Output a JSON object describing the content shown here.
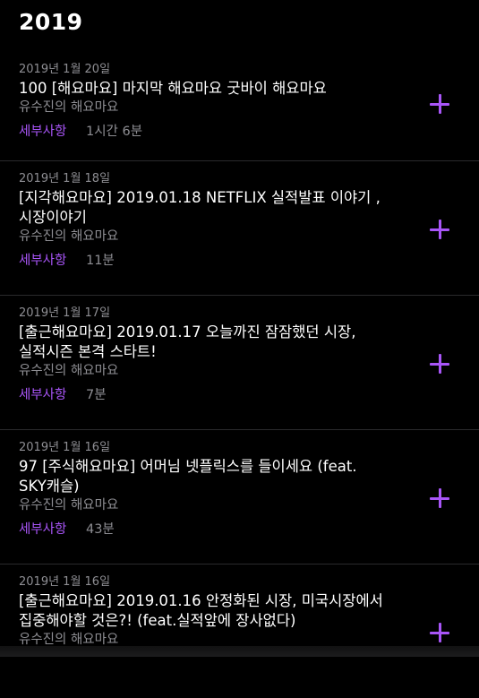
{
  "year": "2019",
  "accent": "#a855f7",
  "episodes": [
    {
      "date": "2019년 1월 20일",
      "title": "100 [해요마요] 마지막 해요마요 굿바이 해요마요",
      "podcast": "유수진의 해요마요",
      "details_label": "세부사항",
      "duration": "1시간 6분",
      "add_icon": "plus-icon"
    },
    {
      "date": "2019년 1월 18일",
      "title": "[지각해요마요] 2019.01.18  NETFLIX 실적발표 이야기 , 시장이야기",
      "podcast": "유수진의 해요마요",
      "details_label": "세부사항",
      "duration": "11분",
      "add_icon": "plus-icon"
    },
    {
      "date": "2019년 1월 17일",
      "title": "[출근해요마요] 2019.01.17 오늘까진 잠잠했던 시장, 실적시즌 본격 스타트!",
      "podcast": "유수진의 해요마요",
      "details_label": "세부사항",
      "duration": "7분",
      "add_icon": "plus-icon"
    },
    {
      "date": "2019년 1월 16일",
      "title": "97 [주식해요마요] 어머님 넷플릭스를 들이세요 (feat. SKY캐슬)",
      "podcast": "유수진의 해요마요",
      "details_label": "세부사항",
      "duration": "43분",
      "add_icon": "plus-icon"
    },
    {
      "date": "2019년 1월 16일",
      "title": "[출근해요마요] 2019.01.16  안정화된 시장, 미국시장에서 집중해야할 것은?! (feat.실적앞에 장사없다)",
      "podcast": "유수진의 해요마요",
      "details_label": "세부사항",
      "duration": "",
      "add_icon": "plus-icon"
    }
  ]
}
